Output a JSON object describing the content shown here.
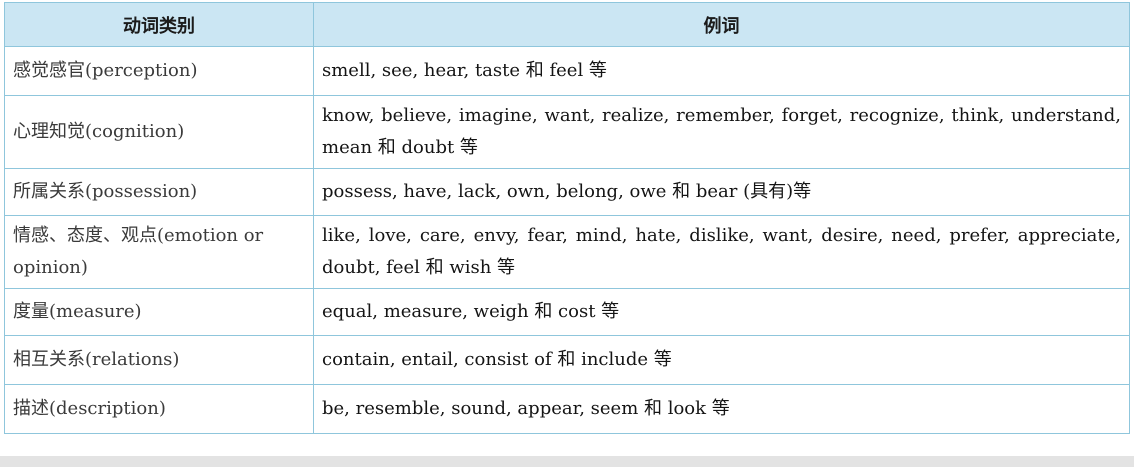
{
  "table": {
    "headers": {
      "category": "动词类别",
      "examples": "例词"
    },
    "rows": [
      {
        "category": "感觉感官(perception)",
        "examples": "smell, see, hear, taste 和 feel 等"
      },
      {
        "category": "心理知觉(cognition)",
        "examples": "know, believe, imagine, want, realize, remember, forget, recognize, think, understand, mean 和 doubt 等"
      },
      {
        "category": "所属关系(possession)",
        "examples": "possess, have, lack, own, belong, owe 和 bear (具有)等"
      },
      {
        "category": "情感、态度、观点(emotion or opinion)",
        "examples": "like, love, care, envy, fear, mind, hate, dislike, want, desire, need, prefer, appreciate, doubt, feel 和 wish 等"
      },
      {
        "category": "度量(measure)",
        "examples": "equal, measure, weigh 和 cost 等"
      },
      {
        "category": "相互关系(relations)",
        "examples": "contain, entail, consist of 和 include 等"
      },
      {
        "category": "描述(description)",
        "examples": "be, resemble, sound, appear, seem 和 look 等"
      }
    ]
  },
  "colors": {
    "header_background": "#cbe6f3",
    "border": "#8fc6dc"
  }
}
